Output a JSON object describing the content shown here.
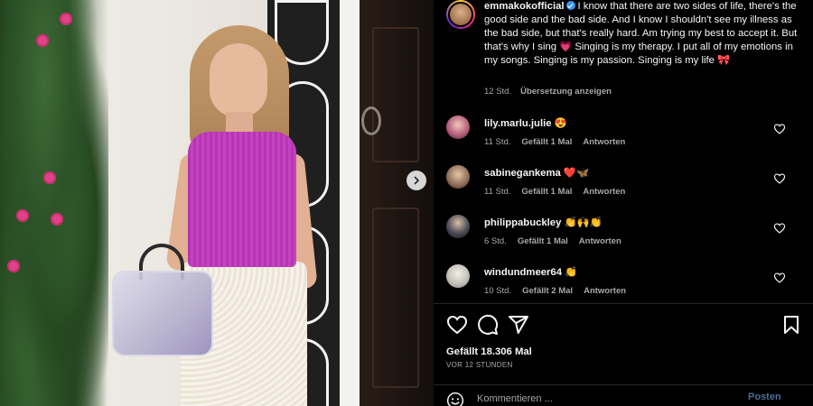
{
  "caption": {
    "username": "emmakokofficial",
    "verified_icon": "verified-badge-icon",
    "text": "I know that there are two sides of life, there's the good side and the bad side. And I know I shouldn't see my illness as the bad side, but that's really hard. Am trying my best to accept it. But that's why I sing 💗 Singing is my therapy. I put all of my emotions in my songs. Singing is my passion. Singing is my life 🎀",
    "time": "12 Std.",
    "translate_label": "Übersetzung anzeigen"
  },
  "comments": [
    {
      "username": "lily.marlu.julie",
      "text": "😍",
      "time": "11 Std.",
      "likes": "Gefällt 1 Mal",
      "reply": "Antworten"
    },
    {
      "username": "sabinegankema",
      "text": "❤️🦋",
      "time": "11 Std.",
      "likes": "Gefällt 1 Mal",
      "reply": "Antworten"
    },
    {
      "username": "philippabuckley",
      "text": "👏🙌👏",
      "time": "6 Std.",
      "likes": "Gefällt 1 Mal",
      "reply": "Antworten"
    },
    {
      "username": "windundmeer64",
      "text": "👏",
      "time": "10 Std.",
      "likes": "Gefällt 2 Mal",
      "reply": "Antworten"
    }
  ],
  "likes_label": "Gefällt 18.306 Mal",
  "posted_time": "VOR 12 STUNDEN",
  "comment_box": {
    "placeholder": "Kommentieren ...",
    "post_label": "Posten"
  },
  "icons": {
    "like": "heart-icon",
    "comment": "comment-icon",
    "share": "share-icon",
    "save": "bookmark-icon",
    "emoji": "emoji-icon",
    "next": "chevron-right-icon"
  },
  "colors": {
    "background": "#000000",
    "text": "#f5f5f5",
    "muted": "#a8a8a8",
    "accent": "#3897f0",
    "post_disabled": "#4a6f94"
  }
}
